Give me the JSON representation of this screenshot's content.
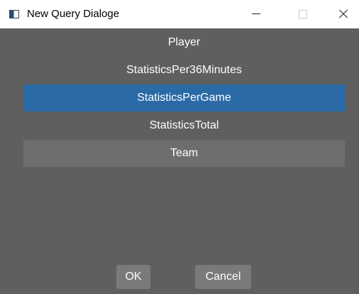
{
  "window": {
    "title": "New Query Dialoge",
    "icon": "app-window-icon"
  },
  "list": {
    "items": [
      {
        "label": "Player",
        "state": "normal"
      },
      {
        "label": "StatisticsPer36Minutes",
        "state": "normal"
      },
      {
        "label": "StatisticsPerGame",
        "state": "selected"
      },
      {
        "label": "StatisticsTotal",
        "state": "normal"
      },
      {
        "label": "Team",
        "state": "hover"
      }
    ]
  },
  "buttons": {
    "ok_label": "OK",
    "cancel_label": "Cancel"
  },
  "colors": {
    "background": "#5f5f5f",
    "selected": "#2a6aa6",
    "hover": "#6e6e6e",
    "button": "#7a7a7a"
  }
}
